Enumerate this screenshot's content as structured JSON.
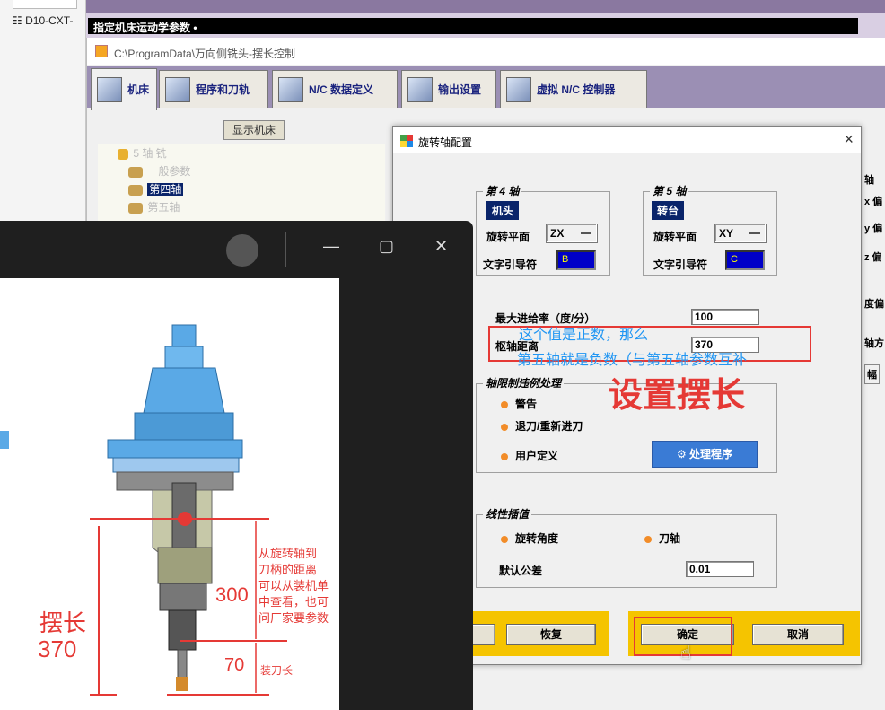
{
  "left_strip": {
    "file_label": "D10-CXT-"
  },
  "prompt_bar": {
    "text": "指定机床运动学参数 •"
  },
  "main_window": {
    "title": "C:\\ProgramData\\万向侧铣头-摆长控制",
    "tabs": [
      {
        "label": "机床"
      },
      {
        "label": "程序和刀轨"
      },
      {
        "label": "N/C 数据定义"
      },
      {
        "label": "输出设置"
      },
      {
        "label": "虚拟 N/C 控制器"
      }
    ],
    "show_machine_button": "显示机床",
    "tree": {
      "root": "5 轴 铣",
      "items": [
        "一般参数",
        "第四轴",
        "第五轴"
      ],
      "selected": "第四轴"
    },
    "right_panel": [
      "轴",
      "x 偏",
      "y 偏",
      "z 偏",
      "度偏",
      "轴方",
      "幅"
    ]
  },
  "dialog": {
    "title": "旋转轴配置",
    "close_icon": "×",
    "axis4": {
      "group_label": "第 4 轴",
      "tag": "机头",
      "plane_label": "旋转平面",
      "plane_value": "ZX",
      "word_label": "文字引导符",
      "word_value": "B"
    },
    "axis5": {
      "group_label": "第 5 轴",
      "tag": "转台",
      "plane_label": "旋转平面",
      "plane_value": "XY",
      "word_label": "文字引导符",
      "word_value": "C"
    },
    "max_feed_label": "最大进给率（度/分）",
    "max_feed_value": "100",
    "pivot_label": "枢轴距离",
    "pivot_value": "370",
    "limit_group": {
      "label": "轴限制违例处理",
      "options": [
        "警告",
        "退刀/重新进刀",
        "用户定义"
      ],
      "process_button": "处理程序"
    },
    "interp_group": {
      "label": "线性插值",
      "options": [
        "旋转角度",
        "刀轴"
      ],
      "tolerance_label": "默认公差",
      "tolerance_value": "0.01"
    },
    "buttons": {
      "restore": "恢复",
      "ok": "确定",
      "cancel": "取消"
    },
    "note_line1": "这个值是正数，那么",
    "note_line2": "第五轴就是负数（与第五轴参数互补",
    "big_note": "设置摆长"
  },
  "viewer": {
    "annotations": {
      "swing_length": "摆长",
      "swing_value": "370",
      "dist_value": "300",
      "tool_value": "70",
      "tool_label": "装刀长",
      "desc": [
        "从旋转轴到",
        "刀柄的距离",
        "可以从装机单",
        "中查看，也可",
        "问厂家要参数"
      ]
    }
  },
  "colors": {
    "accent_red": "#e53935",
    "note_blue": "#2196f3",
    "tab_bg": "#9b8fb4",
    "yellow": "#f5c400"
  }
}
